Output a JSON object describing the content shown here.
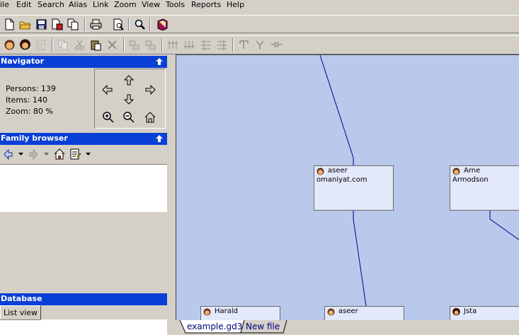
{
  "menu": [
    "ile",
    "Edit",
    "Search",
    "Alias",
    "Link",
    "Zoom",
    "View",
    "Tools",
    "Reports",
    "Help"
  ],
  "toolbar1": [
    "new-file-icon",
    "open-folder-icon",
    "save-icon",
    "save-as-icon",
    "copy-file-icon",
    "print-icon",
    "print-preview-icon",
    "find-icon",
    "book-icon"
  ],
  "toolbar2": [
    "add-male-icon",
    "add-female-icon",
    "edit-icon",
    "copy-icon",
    "cut-icon",
    "paste-icon",
    "delete-icon",
    "link-parent-icon",
    "unlink-icon",
    "tree-down-icon",
    "tree-up-icon",
    "tree-left-icon",
    "tree-right-icon",
    "branch-icon",
    "merge-icon",
    "link-icon"
  ],
  "navigator": {
    "title": "Navigator",
    "persons": "Persons: 139",
    "items": "Items: 140",
    "zoom": "Zoom: 80 %"
  },
  "family_browser": {
    "title": "Family browser"
  },
  "database": {
    "title": "Database",
    "tab": "List view"
  },
  "cards": [
    {
      "name": "aseer",
      "sub": "omaniyat.com",
      "avatar": "male"
    },
    {
      "name": "Arne",
      "sub": "Armodson",
      "avatar": "male"
    },
    {
      "name": "Harald",
      "sub": "",
      "avatar": "male"
    },
    {
      "name": "aseer",
      "sub": "",
      "avatar": "male"
    },
    {
      "name": "Jsta",
      "sub": "",
      "avatar": "female"
    }
  ],
  "file_tabs": [
    "example.gd3",
    "New file"
  ],
  "colors": {
    "panel_header": "#0a3fd6",
    "chart_bg": "#b9c9ec",
    "card_bg": "#e3e8fb",
    "lines": "#00008b"
  }
}
